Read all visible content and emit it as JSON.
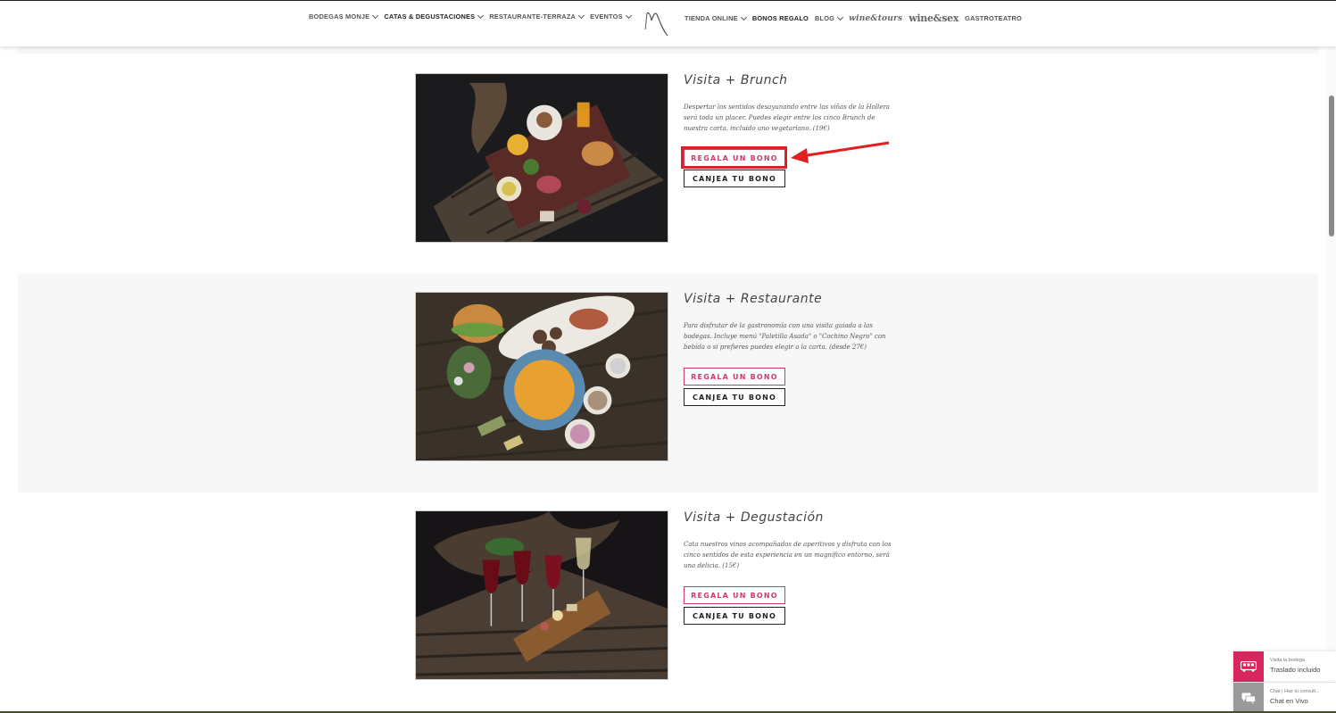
{
  "nav": {
    "left": [
      {
        "label": "BODEGAS MONJE",
        "dropdown": true
      },
      {
        "label": "CATAS & DEGUSTACIONES",
        "dropdown": true
      },
      {
        "label": "RESTAURANTE-TERRAZA",
        "dropdown": true
      },
      {
        "label": "EVENTOS",
        "dropdown": true
      }
    ],
    "logo_icon": "monje-logo-icon",
    "right": {
      "shop": "TIENDA ONLINE",
      "vouchers": "BONOS REGALO",
      "blog": "BLOG",
      "wine_tours": "wine&tours",
      "wine_sex": "wine&sex",
      "theatre": "GASTROTEATRO"
    }
  },
  "products": [
    {
      "title": "Visita + Brunch",
      "description": "Despertar los sentidos desayunando entre las viñas de la Hollera será toda un placer. Puedes elegir entre los cinco Brunch de nuestra carta, incluido uno vegetariano. (19€)",
      "gift_button": "REGALA UN BONO",
      "redeem_button": "CANJEA TU BONO"
    },
    {
      "title": "Visita + Restaurante",
      "description": "Para disfrutar de la gastronomía con una visita guiada a las bodegas. Incluye menú \"Paletilla Asada\" o \"Cochino Negro\" con bebida o si prefieres puedes elegir a la carta. (desde 27€)",
      "gift_button": "REGALA UN BONO",
      "redeem_button": "CANJEA TU BONO"
    },
    {
      "title": "Visita + Degustación",
      "description": "Cata nuestros vinos acompañados de aperitivos y disfruta con los cinco sentidos de esta experiencia en un magnífico entorno, será una delicia. (15€)",
      "gift_button": "REGALA UN BONO",
      "redeem_button": "CANJEA TU BONO"
    }
  ],
  "widgets": {
    "transfer": {
      "small": "Visita la bodega",
      "big": "Traslado incluido",
      "icon": "bus-icon"
    },
    "chat": {
      "small": "Chat | Haz tu consult...",
      "big": "Chat en Vivo",
      "icon": "chat-icon"
    }
  },
  "colors": {
    "accent": "#d03a6b",
    "highlight": "#e02020",
    "widget_pink": "#d8265f",
    "widget_grey": "#9a9a9a"
  }
}
